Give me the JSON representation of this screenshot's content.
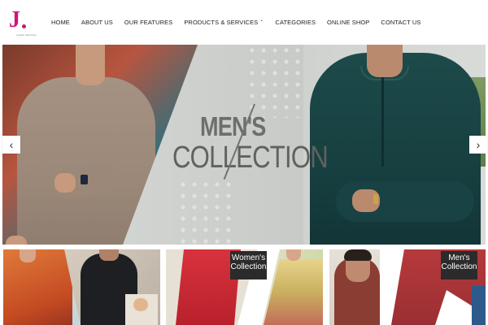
{
  "logo": {
    "letter": "J",
    "sub": "Junaid Jamshed"
  },
  "nav": {
    "items": [
      {
        "label": "HOME",
        "has_dropdown": false
      },
      {
        "label": "ABOUT US",
        "has_dropdown": false
      },
      {
        "label": "OUR FEATURES",
        "has_dropdown": false
      },
      {
        "label": "PRODUCTS & SERVICES",
        "has_dropdown": true
      },
      {
        "label": "CATEGORIES",
        "has_dropdown": false
      },
      {
        "label": "ONLINE SHOP",
        "has_dropdown": false
      },
      {
        "label": "CONTACT US",
        "has_dropdown": false
      }
    ]
  },
  "hero": {
    "title_line1": "MEN'S",
    "title_line2": "COLLECTION",
    "prev_icon": "chevron-left-icon",
    "next_icon": "chevron-right-icon",
    "prev_glyph": "‹",
    "next_glyph": "›"
  },
  "tiles": [
    {
      "label_line1": "",
      "label_line2": ""
    },
    {
      "label_line1": "Women's",
      "label_line2": "Collection"
    },
    {
      "label_line1": "Men's",
      "label_line2": "Collection"
    }
  ],
  "colors": {
    "brand": "#d1147a",
    "label_bg": "#2b2b2b"
  }
}
